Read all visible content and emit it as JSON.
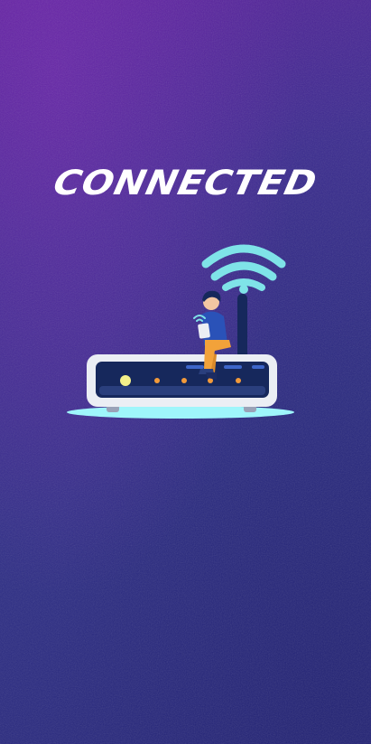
{
  "status": {
    "headline": "CONNECTED"
  },
  "illustration": {
    "icon": "router-wifi-person-icon",
    "colors": {
      "wifi": "#7fe3e8",
      "router_body": "#ebeef4",
      "router_panel": "#16285c",
      "glow": "#9ff6fb",
      "led_primary": "#f4f08a",
      "led_secondary": "#f29a3a",
      "person_shirt": "#2a52b8",
      "person_pants": "#f2a23a"
    }
  },
  "theme": {
    "background_top": "#5a1f9c",
    "background_bottom": "#25257a",
    "text": "#ffffff"
  }
}
